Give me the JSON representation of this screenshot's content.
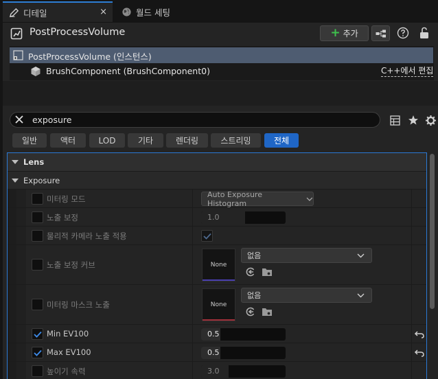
{
  "tabs": [
    {
      "label": "디테일",
      "active": true,
      "close": "×"
    },
    {
      "label": "월드 세팅",
      "active": false
    }
  ],
  "header": {
    "title": "PostProcessVolume",
    "add_label": "추가",
    "add_plus": "+"
  },
  "tree": {
    "instance": "PostProcessVolume (인스턴스)",
    "component": "BrushComponent (BrushComponent0)",
    "edit_link": "C++에서 편집"
  },
  "search": {
    "value": "exposure"
  },
  "filters": [
    "일반",
    "액터",
    "LOD",
    "기타",
    "렌더링",
    "스트리밍",
    "전체"
  ],
  "active_filter": "전체",
  "categories": {
    "lens": "Lens",
    "exposure": "Exposure"
  },
  "properties": {
    "metering_mode": {
      "label": "미터링 모드",
      "value": "Auto Exposure Histogram"
    },
    "exposure_compensation": {
      "label": "노출 보정",
      "value": "1.0"
    },
    "apply_physical_camera": {
      "label": "물리적 카메라 노출 적용"
    },
    "exposure_curve": {
      "label": "노출 보정 커브",
      "asset": "없음",
      "thumb": "None"
    },
    "metering_mask": {
      "label": "미터링 마스크 노출",
      "asset": "없음",
      "thumb": "None"
    },
    "min_ev100": {
      "label": "Min EV100",
      "value": "0.5"
    },
    "max_ev100": {
      "label": "Max EV100",
      "value": "0.5"
    },
    "speed_up": {
      "label": "높이기 속력",
      "value": "3.0"
    }
  },
  "colors": {
    "accent_blue": "#1f66c6",
    "add_green": "#3ec24d",
    "selection": "#4e5c71",
    "curve_bar": "#4a3fb0",
    "mask_bar": "#a0303a"
  }
}
